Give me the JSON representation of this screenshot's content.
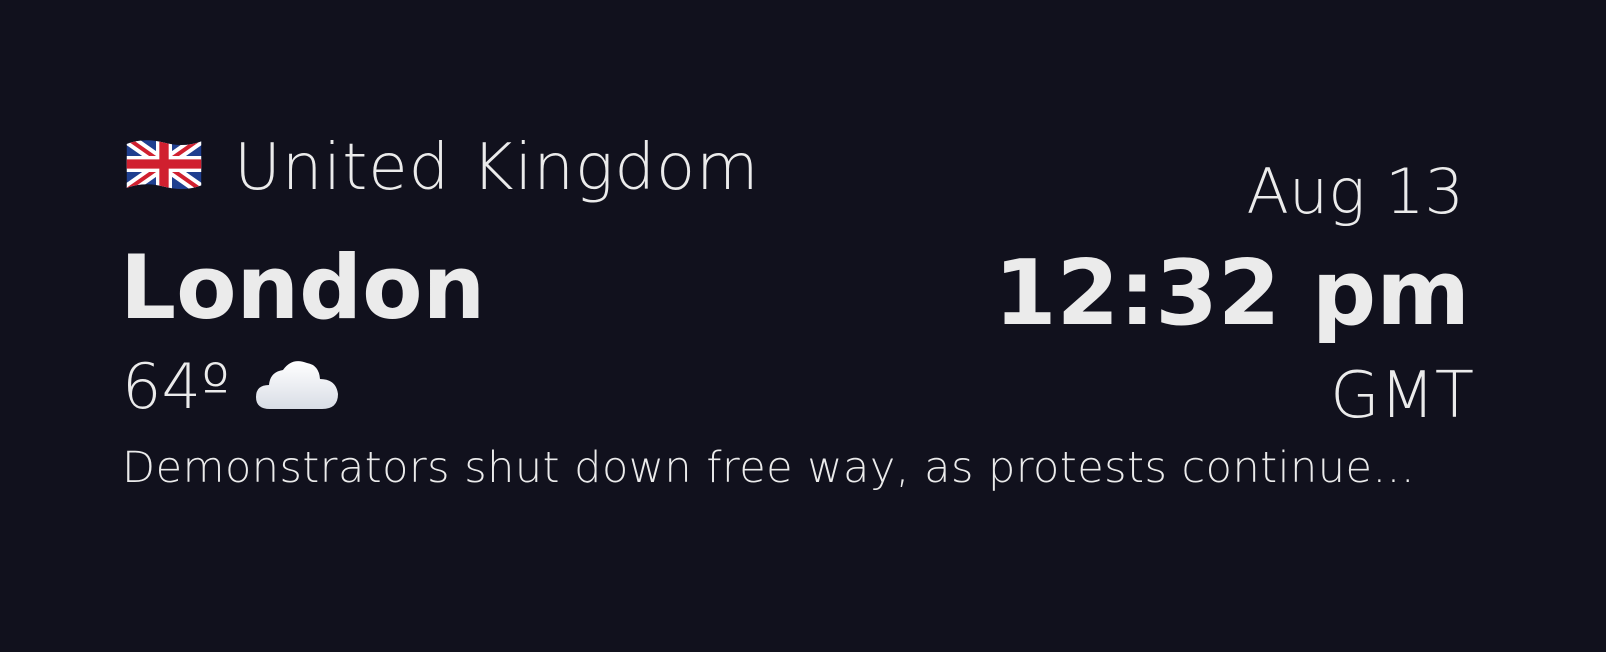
{
  "location": {
    "flag_icon": "uk-flag-icon",
    "country": "United Kingdom",
    "city": "London"
  },
  "weather": {
    "temperature": "64º",
    "condition_icon": "cloud-icon"
  },
  "news": {
    "headline": "Demonstrators shut down free way, as protests continue..."
  },
  "datetime": {
    "date": "Aug 13",
    "time": "12:32 pm",
    "timezone": "GMT"
  },
  "colors": {
    "background": "#11111d",
    "text": "#ebebeb"
  }
}
